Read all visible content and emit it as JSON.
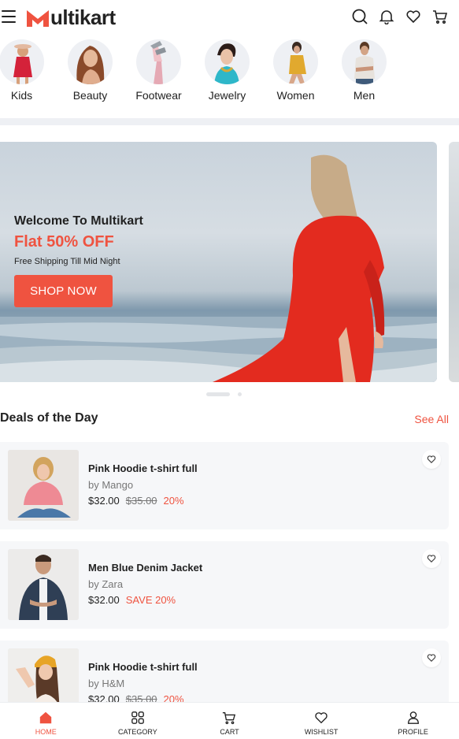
{
  "header": {
    "logo_text": "ultikart",
    "logo_initial": "M"
  },
  "categories": [
    {
      "label": "Kids"
    },
    {
      "label": "Beauty"
    },
    {
      "label": "Footwear"
    },
    {
      "label": "Jewelry"
    },
    {
      "label": "Women"
    },
    {
      "label": "Men"
    }
  ],
  "banner": {
    "welcome": "Welcome To Multikart",
    "offer": "Flat 50% OFF",
    "shipping": "Free Shipping Till Mid Night",
    "cta": "SHOP NOW"
  },
  "deals": {
    "title": "Deals of the Day",
    "see_all": "See All",
    "items": [
      {
        "title": "Pink Hoodie t-shirt full",
        "brand": "by Mango",
        "price": "$32.00",
        "old_price": "$35.00",
        "discount": "20%"
      },
      {
        "title": "Men Blue Denim Jacket",
        "brand": "by Zara",
        "price": "$32.00",
        "old_price": "",
        "discount": "SAVE 20%"
      },
      {
        "title": "Pink Hoodie t-shirt full",
        "brand": "by H&M",
        "price": "$32.00",
        "old_price": "$35.00",
        "discount": "20%"
      }
    ]
  },
  "bottom_nav": [
    {
      "label": "HOME",
      "icon": "home-icon",
      "active": true
    },
    {
      "label": "CATEGORY",
      "icon": "grid-icon",
      "active": false
    },
    {
      "label": "CART",
      "icon": "cart-icon",
      "active": false
    },
    {
      "label": "WISHLIST",
      "icon": "heart-icon",
      "active": false
    },
    {
      "label": "PROFILE",
      "icon": "user-icon",
      "active": false
    }
  ],
  "colors": {
    "accent": "#ef5340",
    "surface": "#f6f7f9",
    "text": "#222222"
  }
}
